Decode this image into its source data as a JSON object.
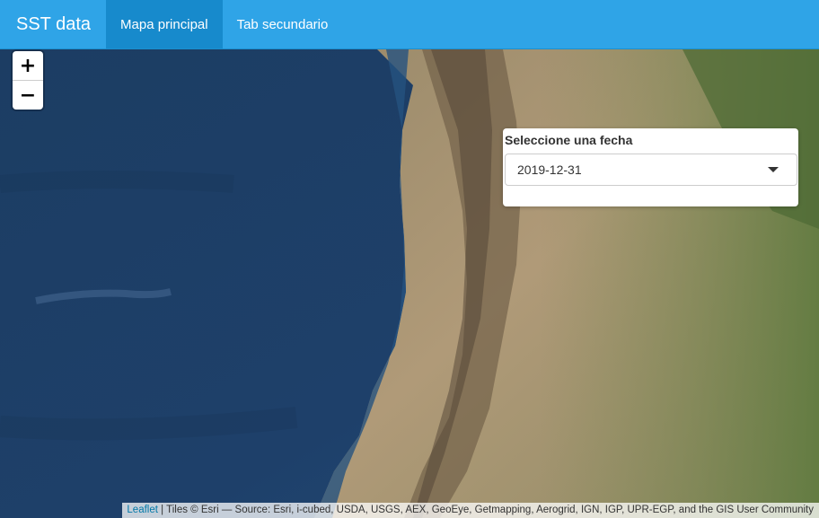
{
  "navbar": {
    "brand": "SST data",
    "tabs": [
      {
        "label": "Mapa principal",
        "active": true
      },
      {
        "label": "Tab secundario",
        "active": false
      }
    ],
    "color": "#2fa4e7",
    "active_color": "#178acc"
  },
  "map": {
    "zoom_in": "+",
    "zoom_out": "−",
    "attribution": {
      "leaflet": "Leaflet",
      "text": " | Tiles © Esri — Source: Esri, i-cubed, USDA, USGS, AEX, GeoEye, Getmapping, Aerogrid, IGN, IGP, UPR-EGP, and the GIS User Community"
    }
  },
  "panel": {
    "label": "Seleccione una fecha",
    "selected_date": "2019-12-31"
  }
}
